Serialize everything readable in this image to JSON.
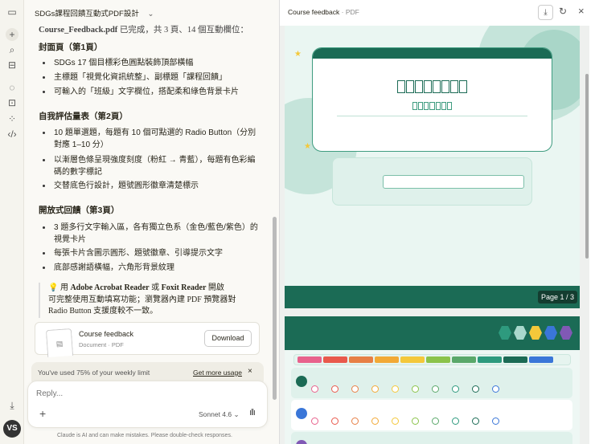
{
  "conversation": {
    "title": "SDGs課程回饋互動式PDF設計"
  },
  "message": {
    "intro_file": "Course_Feedback.pdf",
    "intro_rest": " 已完成，共 3 頁、14 個互動欄位：",
    "sections": [
      {
        "heading": "封面頁（第1頁）",
        "bullets": [
          "SDGs 17 個目標彩色圓點裝飾頂部橫幅",
          "主標題「視覺化資訊統整」、副標題「課程回饋」",
          "可輸入的「班級」文字欄位，搭配柔和綠色背景卡片"
        ]
      },
      {
        "heading": "自我評估量表（第2頁）",
        "bullets": [
          "10 題單選題，每題有 10 個可點選的 Radio Button（分別",
          "對應 1–10 分）",
          "以漸層色條呈現強度刻度（粉紅 → 青藍），每題有色彩編",
          "碼的數字標記",
          "交替底色行設計，題號圓形徽章清楚標示"
        ]
      },
      {
        "heading": "開放式回饋（第3頁）",
        "bullets": [
          "3 題多行文字輸入區，各有獨立色系（金色/藍色/紫色）的",
          "視覺卡片",
          "每張卡片含圖示圓形、題號徽章、引導提示文字",
          "底部感謝語橫幅，六角形背景紋理"
        ]
      }
    ],
    "tip": {
      "icon": "💡",
      "pre": " 用 ",
      "app1": "Adobe Acrobat Reader",
      "mid": " 或 ",
      "app2": "Foxit Reader",
      "post": " 開啟",
      "line2": "可完整使用互動填寫功能；瀏覽器內建 PDF 預覽器對",
      "line3": "Radio Button 支援度較不一致。"
    }
  },
  "artifact": {
    "name": "Course feedback",
    "meta": "Document · PDF",
    "download": "Download"
  },
  "usage": {
    "text": "You've used 75% of your weekly limit",
    "link": "Get more usage"
  },
  "composer": {
    "placeholder": "Reply...",
    "model": "Sonnet 4.6"
  },
  "footer": "Claude is AI and can make mistakes. Please double-check responses.",
  "avatar": "VS",
  "panel": {
    "title": "Course feedback",
    "type": "PDF",
    "page_indicator": "Page 1 / 3"
  },
  "colors": {
    "brand_green": "#1b6b55",
    "scale": [
      "#e8628c",
      "#e9594c",
      "#e77f45",
      "#f2a936",
      "#f4c83a",
      "#8bc34a",
      "#5aa86a",
      "#2e9a7e",
      "#1b6b55",
      "#3a76d8"
    ],
    "hex": [
      "#2e9a7e",
      "#a9d8cc",
      "#f4c83a",
      "#3a76d8",
      "#8059b5"
    ]
  }
}
